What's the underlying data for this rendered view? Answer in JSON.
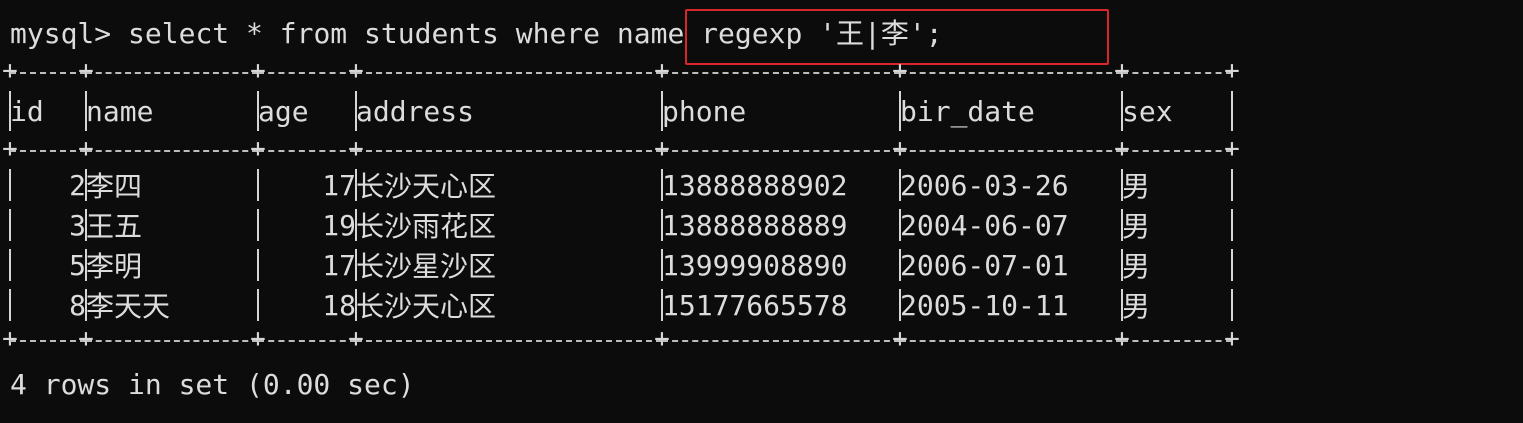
{
  "terminal": {
    "prompt": "mysql> ",
    "command_prefix": "select * from students where ",
    "command_highlight": "name regexp '王|李';",
    "highlight_color": "#d9262b",
    "background": "#0c0c0c",
    "text_color": "#dcdcdc"
  },
  "table": {
    "columns": [
      "id",
      "name",
      "age",
      "address",
      "phone",
      "bir_date",
      "sex"
    ],
    "rows": [
      [
        "2",
        "李四",
        "17",
        "长沙天心区",
        "13888888902",
        "2006-03-26",
        "男"
      ],
      [
        "3",
        "王五",
        "19",
        "长沙雨花区",
        "13888888889",
        "2004-06-07",
        "男"
      ],
      [
        "5",
        "李明",
        "17",
        "长沙星沙区",
        "13999908890",
        "2006-07-01",
        "男"
      ],
      [
        "8",
        "李天天",
        "18",
        "长沙天心区",
        "15177665578",
        "2005-10-11",
        "男"
      ]
    ]
  },
  "footer": "4 rows in set (0.00 sec)"
}
